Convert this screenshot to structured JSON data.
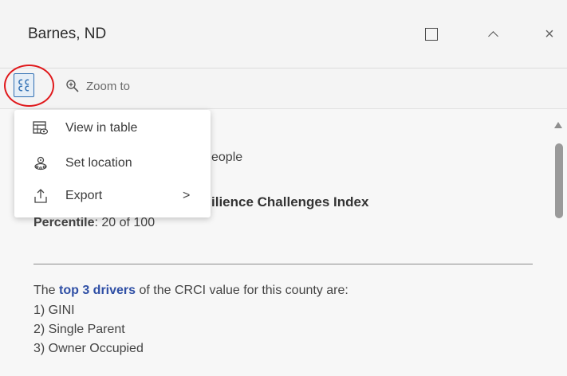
{
  "header": {
    "title": "Barnes, ND"
  },
  "toolbar": {
    "zoom_label": "Zoom to"
  },
  "menu": {
    "items": [
      {
        "label": "View in table",
        "icon": "table-view-icon"
      },
      {
        "label": "Set location",
        "icon": "set-location-icon"
      },
      {
        "label": "Export",
        "icon": "export-icon",
        "submenu": ">"
      }
    ]
  },
  "content": {
    "people_fragment": "eople",
    "index_fragment": "ilience Challenges Index",
    "percentile_label": "Percentile",
    "percentile_value": ": 20 of 100",
    "drivers_prefix": "The ",
    "drivers_link": "top 3 drivers",
    "drivers_suffix": " of the CRCI value for this county are:",
    "drivers": [
      "1) GINI",
      "2) Single Parent",
      "3) Owner Occupied"
    ]
  },
  "colors": {
    "accent": "#2f6fb3",
    "link": "#2f4fa5",
    "highlight": "#e0191c"
  }
}
